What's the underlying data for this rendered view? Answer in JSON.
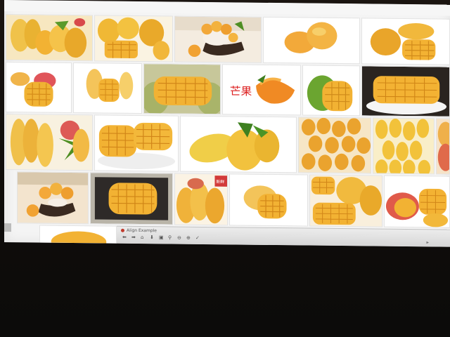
{
  "filter_bar": {
    "items": [
      "",
      "",
      "",
      "",
      "",
      "",
      "",
      "",
      "",
      "",
      "",
      "",
      "",
      "",
      "",
      "",
      "",
      ""
    ]
  },
  "tiles": [
    {
      "name": "mango-tile-1"
    },
    {
      "name": "mango-tile-2"
    },
    {
      "name": "mango-tile-3"
    },
    {
      "name": "mango-tile-4"
    },
    {
      "name": "mango-tile-5"
    },
    {
      "name": "mango-tile-6"
    },
    {
      "name": "mango-tile-7"
    },
    {
      "name": "mango-tile-8"
    },
    {
      "name": "mango-tile-9"
    },
    {
      "name": "mango-tile-10"
    },
    {
      "name": "mango-tile-11"
    },
    {
      "name": "mango-tile-12"
    },
    {
      "name": "mango-tile-13"
    },
    {
      "name": "mango-tile-14"
    },
    {
      "name": "mango-tile-15"
    },
    {
      "name": "mango-tile-16"
    },
    {
      "name": "mango-tile-17"
    },
    {
      "name": "mango-tile-18"
    },
    {
      "name": "mango-tile-19"
    },
    {
      "name": "mango-tile-20"
    },
    {
      "name": "mango-tile-21"
    },
    {
      "name": "mango-tile-22"
    },
    {
      "name": "mango-tile-23"
    }
  ],
  "watermark": {
    "text": "芒果"
  },
  "badge": {
    "text": "新鲜"
  },
  "taskbar": {
    "title": "Align Example",
    "icons": [
      "back-icon",
      "forward-icon",
      "home-icon",
      "down-icon",
      "save-icon",
      "search-icon",
      "zoom-out-icon",
      "zoom-in-icon",
      "tool-icon"
    ]
  },
  "colors": {
    "mango_yellow": "#f2b233",
    "mango_orange": "#f08a24",
    "mango_green": "#5a9a2a",
    "background": "#f4f4f4",
    "monitor_dark": "#0e0c0a"
  }
}
